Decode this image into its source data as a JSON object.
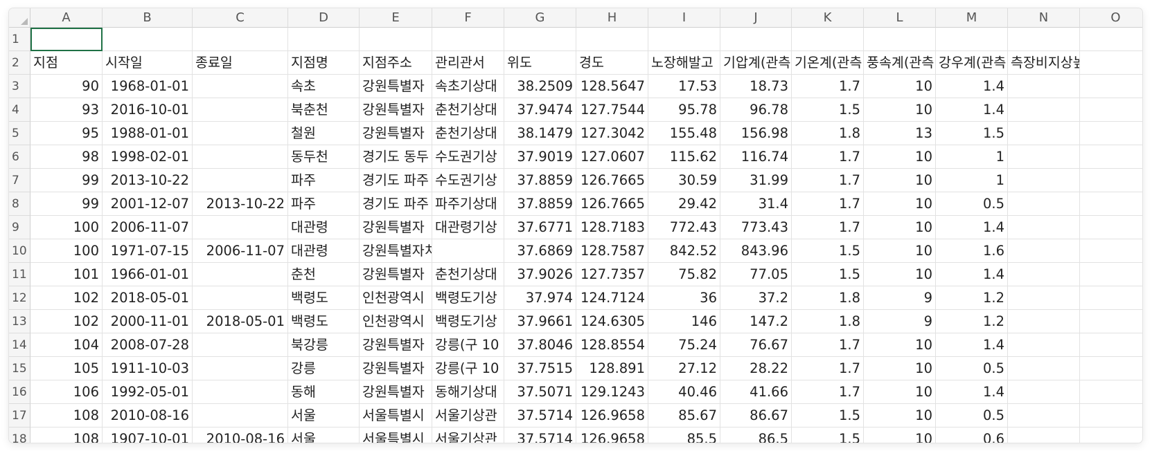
{
  "columns": [
    "A",
    "B",
    "C",
    "D",
    "E",
    "F",
    "G",
    "H",
    "I",
    "J",
    "K",
    "L",
    "M",
    "N",
    "O"
  ],
  "rows": [
    {
      "n": "1",
      "cells": [
        "",
        "",
        "",
        "",
        "",
        "",
        "",
        "",
        "",
        "",
        "",
        "",
        "",
        "",
        ""
      ]
    },
    {
      "n": "2",
      "cells": [
        "지점",
        "시작일",
        "종료일",
        "지점명",
        "지점주소",
        "관리관서",
        "위도",
        "경도",
        "노장해발고",
        "기압계(관측",
        "기온계(관측",
        "풍속계(관측",
        "강우계(관측",
        "측장비지상높이(m))",
        ""
      ]
    },
    {
      "n": "3",
      "cells": [
        "90",
        "1968-01-01",
        "",
        "속초",
        "강원특별자",
        "속초기상대",
        "38.2509",
        "128.5647",
        "17.53",
        "18.73",
        "1.7",
        "10",
        "1.4",
        "",
        ""
      ]
    },
    {
      "n": "4",
      "cells": [
        "93",
        "2016-10-01",
        "",
        "북춘천",
        "강원특별자",
        "춘천기상대",
        "37.9474",
        "127.7544",
        "95.78",
        "96.78",
        "1.5",
        "10",
        "1.4",
        "",
        ""
      ]
    },
    {
      "n": "5",
      "cells": [
        "95",
        "1988-01-01",
        "",
        "철원",
        "강원특별자",
        "춘천기상대",
        "38.1479",
        "127.3042",
        "155.48",
        "156.98",
        "1.8",
        "13",
        "1.5",
        "",
        ""
      ]
    },
    {
      "n": "6",
      "cells": [
        "98",
        "1998-02-01",
        "",
        "동두천",
        "경기도 동두",
        "수도권기상",
        "37.9019",
        "127.0607",
        "115.62",
        "116.74",
        "1.7",
        "10",
        "1",
        "",
        ""
      ]
    },
    {
      "n": "7",
      "cells": [
        "99",
        "2013-10-22",
        "",
        "파주",
        "경기도 파주",
        "수도권기상",
        "37.8859",
        "126.7665",
        "30.59",
        "31.99",
        "1.7",
        "10",
        "1",
        "",
        ""
      ]
    },
    {
      "n": "8",
      "cells": [
        "99",
        "2001-12-07",
        "2013-10-22",
        "파주",
        "경기도 파주",
        "파주기상대",
        "37.8859",
        "126.7665",
        "29.42",
        "31.4",
        "1.7",
        "10",
        "0.5",
        "",
        ""
      ]
    },
    {
      "n": "9",
      "cells": [
        "100",
        "2006-11-07",
        "",
        "대관령",
        "강원특별자",
        "대관령기상",
        "37.6771",
        "128.7183",
        "772.43",
        "773.43",
        "1.7",
        "10",
        "1.4",
        "",
        ""
      ]
    },
    {
      "n": "10",
      "cells": [
        "100",
        "1971-07-15",
        "2006-11-07",
        "대관령",
        "강원특별자치도 평창",
        "",
        "37.6869",
        "128.7587",
        "842.52",
        "843.96",
        "1.5",
        "10",
        "1.6",
        "",
        ""
      ]
    },
    {
      "n": "11",
      "cells": [
        "101",
        "1966-01-01",
        "",
        "춘천",
        "강원특별자",
        "춘천기상대",
        "37.9026",
        "127.7357",
        "75.82",
        "77.05",
        "1.5",
        "10",
        "1.4",
        "",
        ""
      ]
    },
    {
      "n": "12",
      "cells": [
        "102",
        "2018-05-01",
        "",
        "백령도",
        "인천광역시",
        "백령도기상",
        "37.974",
        "124.7124",
        "36",
        "37.2",
        "1.8",
        "9",
        "1.2",
        "",
        ""
      ]
    },
    {
      "n": "13",
      "cells": [
        "102",
        "2000-11-01",
        "2018-05-01",
        "백령도",
        "인천광역시",
        "백령도기상",
        "37.9661",
        "124.6305",
        "146",
        "147.2",
        "1.8",
        "9",
        "1.2",
        "",
        ""
      ]
    },
    {
      "n": "14",
      "cells": [
        "104",
        "2008-07-28",
        "",
        "북강릉",
        "강원특별자",
        "강릉(구 10",
        "37.8046",
        "128.8554",
        "75.24",
        "76.67",
        "1.7",
        "10",
        "1.4",
        "",
        ""
      ]
    },
    {
      "n": "15",
      "cells": [
        "105",
        "1911-10-03",
        "",
        "강릉",
        "강원특별자",
        "강릉(구 10",
        "37.7515",
        "128.891",
        "27.12",
        "28.22",
        "1.7",
        "10",
        "0.5",
        "",
        ""
      ]
    },
    {
      "n": "16",
      "cells": [
        "106",
        "1992-05-01",
        "",
        "동해",
        "강원특별자",
        "동해기상대",
        "37.5071",
        "129.1243",
        "40.46",
        "41.66",
        "1.7",
        "10",
        "1.4",
        "",
        ""
      ]
    },
    {
      "n": "17",
      "cells": [
        "108",
        "2010-08-16",
        "",
        "서울",
        "서울특별시",
        "서울기상관",
        "37.5714",
        "126.9658",
        "85.67",
        "86.67",
        "1.5",
        "10",
        "0.5",
        "",
        ""
      ]
    },
    {
      "n": "18",
      "cells": [
        "108",
        "1907-10-01",
        "2010-08-16",
        "서울",
        "서울특별시",
        "서울기상관",
        "37.5714",
        "126.9658",
        "85.5",
        "86.5",
        "1.5",
        "10",
        "0.6",
        "",
        ""
      ]
    }
  ]
}
